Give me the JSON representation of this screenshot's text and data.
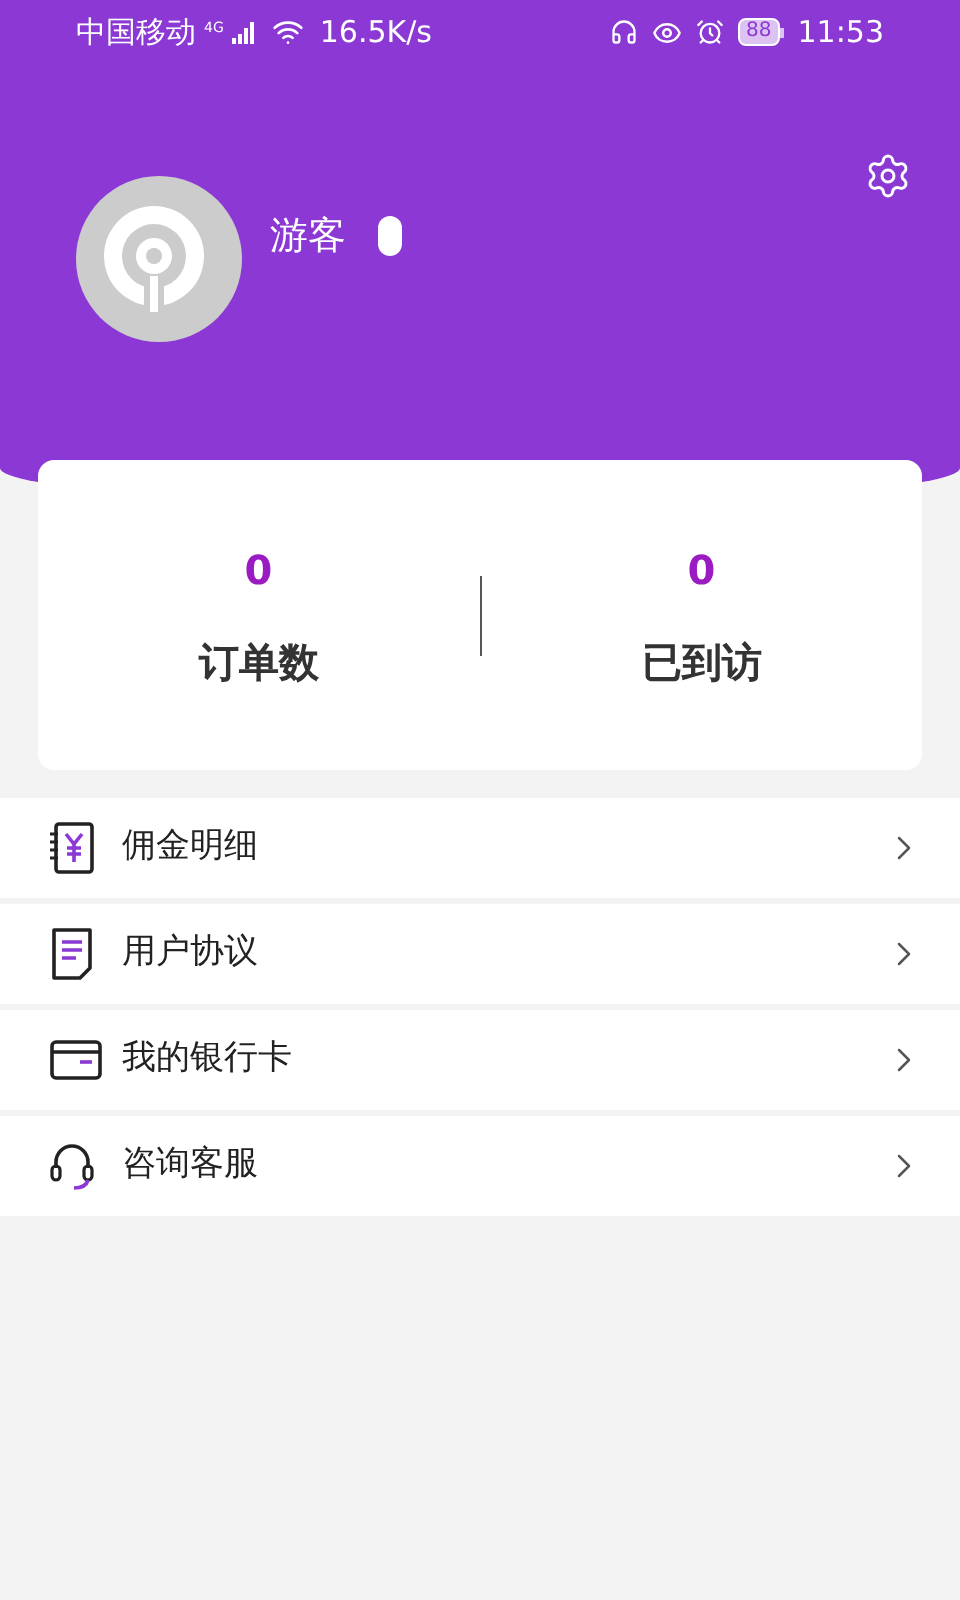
{
  "status_bar": {
    "carrier": "中国移动",
    "network": "4G",
    "speed": "16.5K/s",
    "battery": "88",
    "time": "11:53"
  },
  "profile": {
    "name": "游客"
  },
  "stats": [
    {
      "value": "0",
      "label": "订单数"
    },
    {
      "value": "0",
      "label": "已到访"
    }
  ],
  "menu": [
    {
      "kind": "commission",
      "label": "佣金明细"
    },
    {
      "kind": "agreement",
      "label": "用户协议"
    },
    {
      "kind": "card",
      "label": "我的银行卡"
    },
    {
      "kind": "support",
      "label": "咨询客服"
    }
  ]
}
